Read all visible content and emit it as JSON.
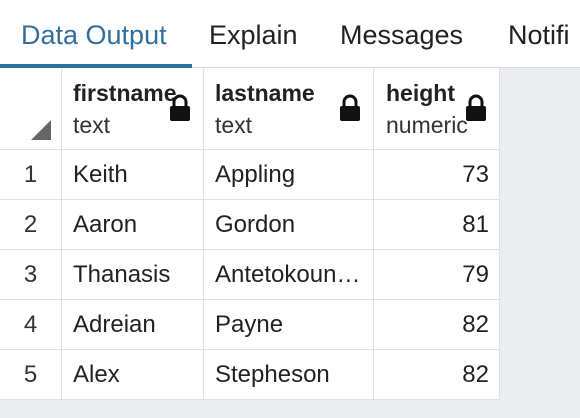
{
  "tabs": [
    {
      "label": "Data Output",
      "active": true
    },
    {
      "label": "Explain",
      "active": false
    },
    {
      "label": "Messages",
      "active": false
    },
    {
      "label": "Notifi",
      "active": false
    }
  ],
  "columns": [
    {
      "name": "firstname",
      "type": "text",
      "icon": "lock-icon"
    },
    {
      "name": "lastname",
      "type": "text",
      "icon": "lock-icon"
    },
    {
      "name": "height",
      "type": "numeric",
      "icon": "lock-icon"
    }
  ],
  "rows": [
    {
      "num": "1",
      "firstname": "Keith",
      "lastname": "Appling",
      "height": "73"
    },
    {
      "num": "2",
      "firstname": "Aaron",
      "lastname": "Gordon",
      "height": "81"
    },
    {
      "num": "3",
      "firstname": "Thanasis",
      "lastname": "Antetokoun…",
      "height": "79"
    },
    {
      "num": "4",
      "firstname": "Adreian",
      "lastname": "Payne",
      "height": "82"
    },
    {
      "num": "5",
      "firstname": "Alex",
      "lastname": "Stepheson",
      "height": "82"
    }
  ],
  "colors": {
    "accent": "#2c6fa3",
    "active_tab_text": "#346e9c"
  }
}
